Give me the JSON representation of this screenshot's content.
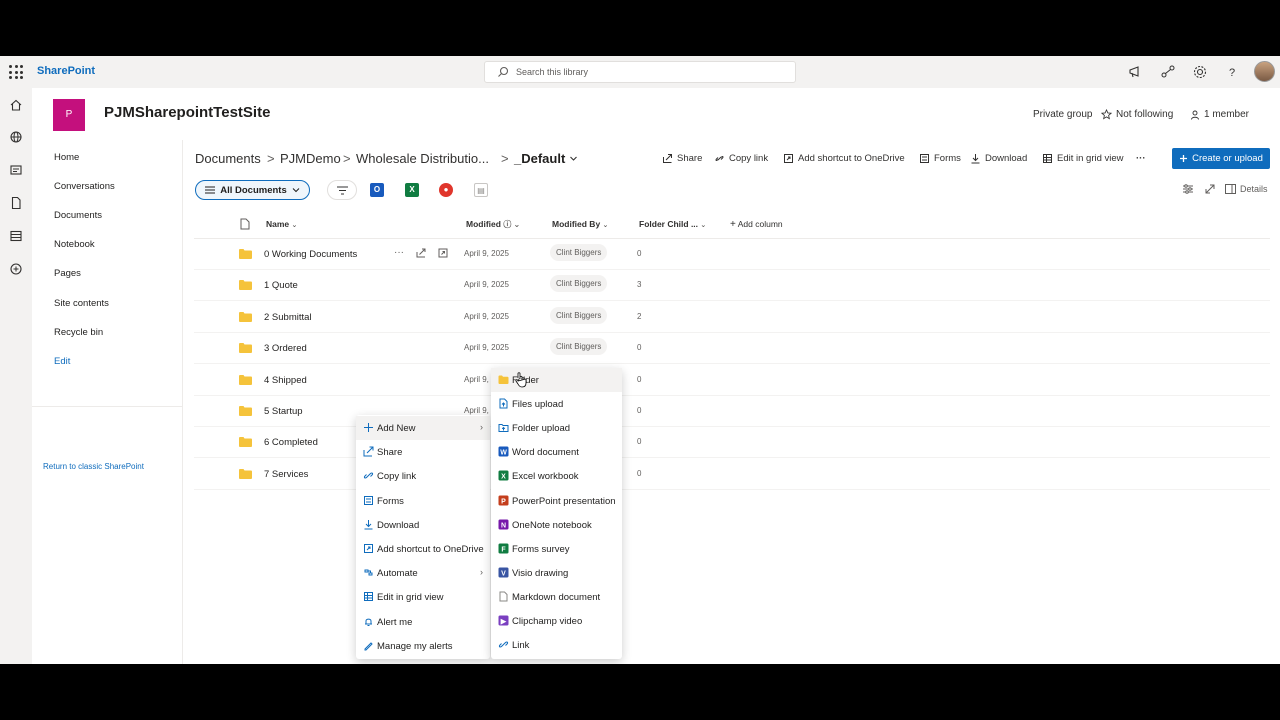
{
  "suite": {
    "app_name": "SharePoint",
    "search_placeholder": "Search this library"
  },
  "site": {
    "logo_letter": "P",
    "title": "PJMSharepointTestSite",
    "group_type": "Private group",
    "follow_label": "Not following",
    "members_label": "1 member"
  },
  "nav": {
    "items": [
      "Home",
      "Conversations",
      "Documents",
      "Notebook",
      "Pages",
      "Site contents",
      "Recycle bin",
      "Edit"
    ],
    "classic_link": "Return to classic SharePoint"
  },
  "breadcrumb": {
    "items": [
      "Documents",
      "PJMDemo",
      "Wholesale Distributio...",
      "_Default"
    ],
    "separator": ">"
  },
  "commands": {
    "share": "Share",
    "copy_link": "Copy link",
    "add_shortcut": "Add shortcut to OneDrive",
    "forms": "Forms",
    "download": "Download",
    "grid_view": "Edit in grid view",
    "more": "···",
    "create_upload": "Create or upload"
  },
  "view": {
    "current_view": "All Documents",
    "details_label": "Details"
  },
  "columns": {
    "name": "Name",
    "modified": "Modified",
    "modified_by": "Modified By",
    "folder_child": "Folder Child ...",
    "add_column": "Add column"
  },
  "rows": [
    {
      "name": "0 Working Documents",
      "modified": "April 9, 2025",
      "by": "Clint Biggers",
      "count": "0"
    },
    {
      "name": "1 Quote",
      "modified": "April 9, 2025",
      "by": "Clint Biggers",
      "count": "3"
    },
    {
      "name": "2 Submittal",
      "modified": "April 9, 2025",
      "by": "Clint Biggers",
      "count": "2"
    },
    {
      "name": "3 Ordered",
      "modified": "April 9, 2025",
      "by": "Clint Biggers",
      "count": "0"
    },
    {
      "name": "4 Shipped",
      "modified": "April 9,",
      "by": "",
      "count": "0"
    },
    {
      "name": "5 Startup",
      "modified": "April 9,",
      "by": "",
      "count": "0"
    },
    {
      "name": "6 Completed",
      "modified": "",
      "by": "",
      "count": "0"
    },
    {
      "name": "7 Services",
      "modified": "",
      "by": "",
      "count": "0"
    }
  ],
  "context_menu": {
    "items": [
      {
        "label": "Add New",
        "icon": "plus-icon",
        "submenu": true
      },
      {
        "label": "Share",
        "icon": "share-icon"
      },
      {
        "label": "Copy link",
        "icon": "link-icon"
      },
      {
        "label": "Forms",
        "icon": "forms-icon"
      },
      {
        "label": "Download",
        "icon": "download-icon"
      },
      {
        "label": "Add shortcut to OneDrive",
        "icon": "shortcut-icon"
      },
      {
        "label": "Automate",
        "icon": "automate-icon",
        "submenu": true
      },
      {
        "label": "Edit in grid view",
        "icon": "grid-icon"
      },
      {
        "label": "Alert me",
        "icon": "bell-icon"
      },
      {
        "label": "Manage my alerts",
        "icon": "manage-alerts-icon"
      }
    ]
  },
  "add_new_menu": {
    "items": [
      {
        "label": "Folder",
        "icon": "folder-icon"
      },
      {
        "label": "Files upload",
        "icon": "file-upload-icon"
      },
      {
        "label": "Folder upload",
        "icon": "folder-upload-icon"
      },
      {
        "label": "Word document",
        "icon": "word-icon"
      },
      {
        "label": "Excel workbook",
        "icon": "excel-icon"
      },
      {
        "label": "PowerPoint presentation",
        "icon": "powerpoint-icon"
      },
      {
        "label": "OneNote notebook",
        "icon": "onenote-icon"
      },
      {
        "label": "Forms survey",
        "icon": "forms-survey-icon"
      },
      {
        "label": "Visio drawing",
        "icon": "visio-icon"
      },
      {
        "label": "Markdown document",
        "icon": "markdown-icon"
      },
      {
        "label": "Clipchamp video",
        "icon": "clipchamp-icon"
      },
      {
        "label": "Link",
        "icon": "link-icon"
      }
    ]
  },
  "colors": {
    "accent": "#0f6cbd",
    "site_logo": "#c4107d",
    "folder": "#f5c33b",
    "word": "#185abd",
    "excel": "#107c41",
    "powerpoint": "#c43e1c",
    "onenote": "#7719aa",
    "visio": "#3955a3",
    "clipchamp": "#7a3fc0"
  }
}
